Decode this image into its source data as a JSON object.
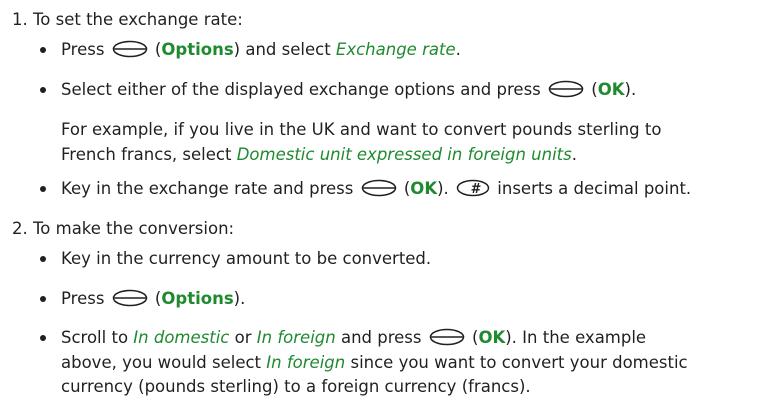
{
  "steps": [
    {
      "number": "1.",
      "heading": "To set the exchange rate:",
      "bullets": [
        {
          "press": "Press",
          "options": "Options",
          "and_select": "and select",
          "target": "Exchange rate",
          "end": "."
        },
        {
          "text": "Select either of the displayed exchange options and press",
          "ok": "OK",
          "end": ")."
        },
        {
          "text": "Key in the exchange rate and press",
          "ok": "OK",
          "after": "inserts a decimal point."
        }
      ],
      "example": {
        "line1": "For example, if you live in the UK and want to convert pounds sterling to",
        "line2": "French francs, select",
        "target": "Domestic unit expressed in foreign units",
        "end": "."
      }
    },
    {
      "number": "2.",
      "heading": "To make the conversion:",
      "bullets": [
        {
          "text": "Key in the currency amount to be converted."
        },
        {
          "press": "Press",
          "options": "Options",
          "end": ")."
        },
        {
          "scroll": "Scroll to",
          "domestic": "In domestic",
          "or": "or",
          "foreign": "In foreign",
          "and_press": "and press",
          "ok": "OK",
          "after": "). In the example",
          "line2_pre": "above, you would select",
          "line2_target": "In foreign",
          "line2_post": "since you want to convert your domestic",
          "line3": "currency (pounds sterling) to a foreign currency (francs)."
        }
      ]
    }
  ],
  "icons": [
    "selection-key-icon",
    "hash-key-icon"
  ]
}
